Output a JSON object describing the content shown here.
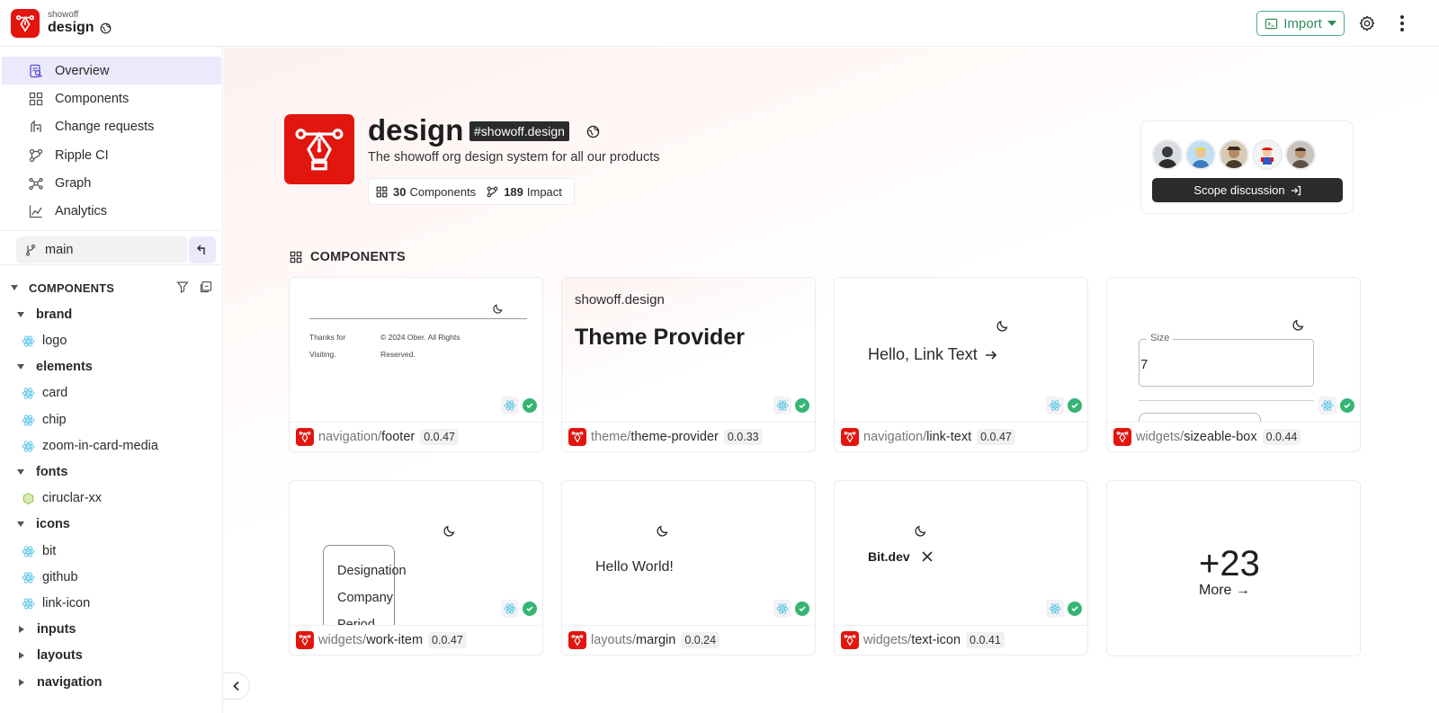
{
  "header": {
    "org": "showoff",
    "scope": "design",
    "import_label": "Import"
  },
  "sidebar": {
    "nav": [
      {
        "label": "Overview",
        "icon": "overview-icon",
        "active": true
      },
      {
        "label": "Components",
        "icon": "components-icon"
      },
      {
        "label": "Change requests",
        "icon": "change-requests-icon"
      },
      {
        "label": "Ripple CI",
        "icon": "ripple-ci-icon"
      },
      {
        "label": "Graph",
        "icon": "graph-icon"
      },
      {
        "label": "Analytics",
        "icon": "analytics-icon"
      }
    ],
    "branch": "main",
    "components_heading": "COMPONENTS",
    "tree": [
      {
        "label": "brand",
        "type": "folder",
        "expanded": true
      },
      {
        "label": "logo",
        "type": "react"
      },
      {
        "label": "elements",
        "type": "folder",
        "expanded": true
      },
      {
        "label": "card",
        "type": "react"
      },
      {
        "label": "chip",
        "type": "react"
      },
      {
        "label": "zoom-in-card-media",
        "type": "react"
      },
      {
        "label": "fonts",
        "type": "folder",
        "expanded": true
      },
      {
        "label": "ciruclar-xx",
        "type": "env"
      },
      {
        "label": "icons",
        "type": "folder",
        "expanded": true
      },
      {
        "label": "bit",
        "type": "react"
      },
      {
        "label": "github",
        "type": "react"
      },
      {
        "label": "link-icon",
        "type": "react"
      },
      {
        "label": "inputs",
        "type": "folder",
        "expanded": false
      },
      {
        "label": "layouts",
        "type": "folder",
        "expanded": false
      },
      {
        "label": "navigation",
        "type": "folder",
        "expanded": false
      }
    ]
  },
  "hero": {
    "title": "design",
    "tag": "#showoff.design",
    "description": "The showoff org design system for all our products",
    "components_count": "30",
    "components_label": "Components",
    "impact_count": "189",
    "impact_label": "Impact",
    "scope_discussion_label": "Scope discussion"
  },
  "section_title": "COMPONENTS",
  "cards": [
    {
      "ns": "navigation/",
      "name": "footer",
      "version": "0.0.47",
      "preview": {
        "left": "Thanks for Visiting.",
        "right": "© 2024 Ober. All Rights Reserved."
      }
    },
    {
      "ns": "theme/",
      "name": "theme-provider",
      "version": "0.0.33",
      "preview": {
        "small": "showoff.design",
        "big": "Theme Provider"
      }
    },
    {
      "ns": "navigation/",
      "name": "link-text",
      "version": "0.0.47",
      "preview": {
        "text": "Hello, Link Text"
      }
    },
    {
      "ns": "widgets/",
      "name": "sizeable-box",
      "version": "0.0.44",
      "preview": {
        "legend": "Size",
        "value": "7"
      }
    },
    {
      "ns": "widgets/",
      "name": "work-item",
      "version": "0.0.47",
      "preview": {
        "lines": [
          "Designation",
          "Company",
          "Period"
        ]
      }
    },
    {
      "ns": "layouts/",
      "name": "margin",
      "version": "0.0.24",
      "preview": {
        "text": "Hello World!"
      }
    },
    {
      "ns": "widgets/",
      "name": "text-icon",
      "version": "0.0.41",
      "preview": {
        "text": "Bit.dev"
      }
    }
  ],
  "more": {
    "count": "+23",
    "label": "More →"
  },
  "colors": {
    "brand": "#e3150f",
    "accent_green": "#35b573",
    "active_bg": "#ebe9fb"
  }
}
